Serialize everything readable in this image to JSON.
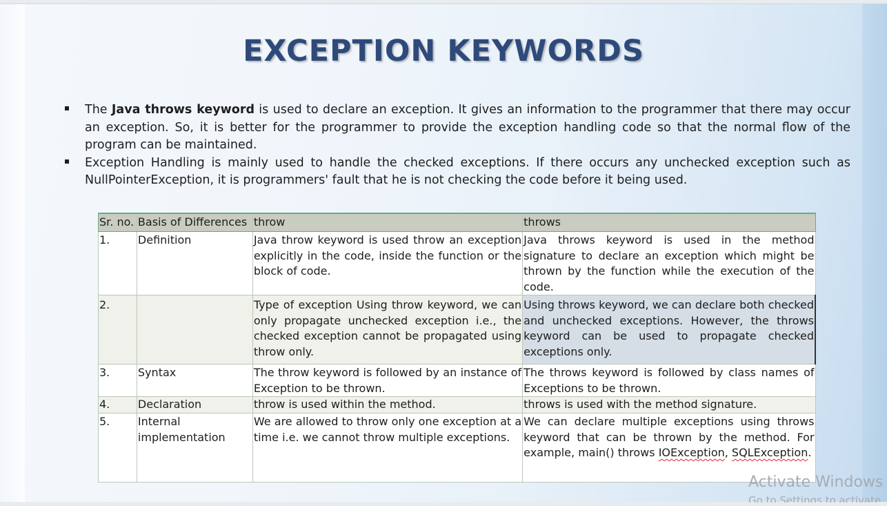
{
  "slide": {
    "title": "EXCEPTION KEYWORDS",
    "bullets": [
      {
        "pre": "The ",
        "bold": "Java throws keyword",
        "post": " is used to declare an exception. It gives an information to the programmer that there may occur an exception. So, it is better for the programmer to provide the exception handling code so that the normal flow of the program can be maintained."
      },
      {
        "pre": "Exception Handling is mainly used to handle the checked exceptions. If there occurs any unchecked exception such as NullPointerException, it is programmers' fault that he is not checking the code before it being used.",
        "bold": "",
        "post": ""
      }
    ]
  },
  "table": {
    "headers": [
      "Sr. no.",
      "Basis of Differences",
      "throw",
      "throws"
    ],
    "rows": [
      {
        "sr": "1.",
        "basis": "Definition",
        "throw": "Java throw keyword is used throw an exception explicitly in the code, inside the function or the block of code.",
        "throws": "Java throws keyword is used in the method signature to declare an exception which might be thrown by the function while the execution of the code."
      },
      {
        "sr": "2.",
        "basis": "",
        "throw": "Type of exception Using throw keyword, we can only propagate unchecked exception i.e., the checked exception cannot be propagated using throw only.",
        "throws": "Using throws keyword, we can declare both checked and unchecked exceptions. However, the throws keyword can be used to propagate checked exceptions only."
      },
      {
        "sr": "3.",
        "basis": "Syntax",
        "throw": "The throw keyword is followed by an instance of Exception to be thrown.",
        "throws": "The throws keyword is followed by class names of Exceptions to be thrown."
      },
      {
        "sr": "4.",
        "basis": "Declaration",
        "throw": "throw is used within the method.",
        "throws": "throws is used with the method signature."
      },
      {
        "sr": "5.",
        "basis": "Internal implementation",
        "throw": "We are allowed to throw only one exception at a time i.e. we cannot throw multiple exceptions.",
        "throws_pre": "We can declare multiple exceptions using throws keyword that can be thrown by the method. For example, main() throws ",
        "throws_ex1": "IOException",
        "throws_sep": ", ",
        "throws_ex2": "SQLException",
        "throws_post": "."
      }
    ]
  },
  "watermark": {
    "line1": "Activate Windows",
    "line2": "Go to Settings to activate"
  }
}
